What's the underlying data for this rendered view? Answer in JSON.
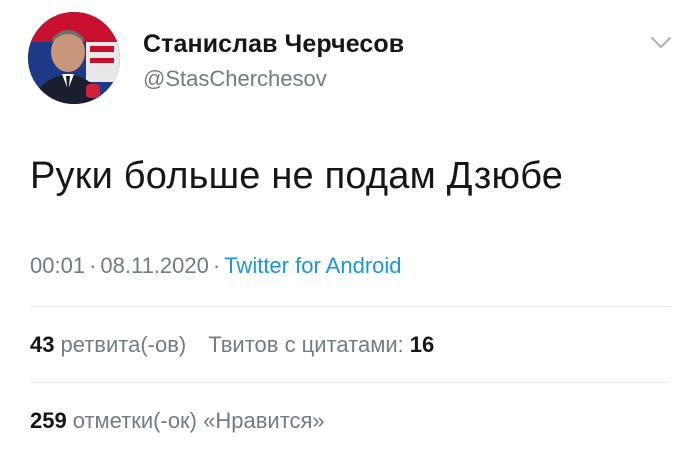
{
  "author": {
    "display_name": "Станислав Черчесов",
    "handle": "@StasCherchesov",
    "avatar_icon": "profile-photo",
    "menu_icon": "chevron-down-icon"
  },
  "tweet": {
    "text": "Руки больше не подам Дзюбе",
    "time": "00:01",
    "separator": "·",
    "date": "08.11.2020",
    "source": "Twitter for Android"
  },
  "stats": {
    "retweets_count": "43",
    "retweets_label": "ретвита(-ов)",
    "quotes_label": "Твитов с цитатами:",
    "quotes_count": "16",
    "likes_count": "259",
    "likes_label": "отметки(-ок) «Нравится»"
  },
  "colors": {
    "text": "#14171a",
    "secondary": "#707c86",
    "link": "#1b95e0",
    "divider": "#e2e6ea"
  }
}
